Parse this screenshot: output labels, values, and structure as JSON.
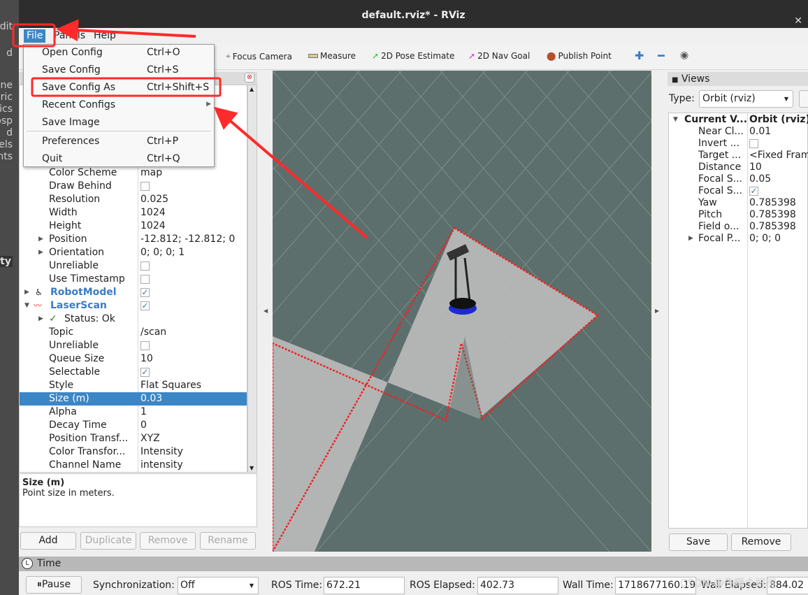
{
  "background_fragments": [
    "dit",
    "d",
    "ne",
    "eric",
    "sics",
    "nosp",
    "d",
    "dels",
    "nts",
    "rty"
  ],
  "window": {
    "title": "default.rviz* - RViz"
  },
  "menubar": [
    "File",
    "Panels",
    "Help"
  ],
  "file_menu": [
    {
      "label": "Open Config",
      "shortcut": "Ctrl+O"
    },
    {
      "label": "Save Config",
      "shortcut": "Ctrl+S"
    },
    {
      "label": "Save Config As",
      "shortcut": "Ctrl+Shift+S"
    },
    {
      "label": "Recent Configs",
      "shortcut": ""
    },
    {
      "label": "Save Image",
      "shortcut": ""
    },
    {
      "label": "Preferences",
      "shortcut": "Ctrl+P"
    },
    {
      "label": "Quit",
      "shortcut": "Ctrl+Q"
    }
  ],
  "toolbar": [
    "Focus Camera",
    "Measure",
    "2D Pose Estimate",
    "2D Nav Goal",
    "Publish Point"
  ],
  "displays": {
    "rows": [
      {
        "k": "Color Scheme",
        "v": "map"
      },
      {
        "k": "Draw Behind",
        "v": ""
      },
      {
        "k": "Resolution",
        "v": "0.025"
      },
      {
        "k": "Width",
        "v": "1024"
      },
      {
        "k": "Height",
        "v": "1024"
      },
      {
        "k": "Position",
        "v": "-12.812; -12.812; 0"
      },
      {
        "k": "Orientation",
        "v": "0; 0; 0; 1"
      },
      {
        "k": "Unreliable",
        "v": ""
      },
      {
        "k": "Use Timestamp",
        "v": ""
      },
      {
        "k": "RobotModel",
        "v": ""
      },
      {
        "k": "LaserScan",
        "v": ""
      },
      {
        "k": "Status: Ok",
        "v": ""
      },
      {
        "k": "Topic",
        "v": "/scan"
      },
      {
        "k": "Unreliable",
        "v": ""
      },
      {
        "k": "Queue Size",
        "v": "10"
      },
      {
        "k": "Selectable",
        "v": ""
      },
      {
        "k": "Style",
        "v": "Flat Squares"
      },
      {
        "k": "Size (m)",
        "v": "0.03"
      },
      {
        "k": "Alpha",
        "v": "1"
      },
      {
        "k": "Decay Time",
        "v": "0"
      },
      {
        "k": "Position Transf...",
        "v": "XYZ"
      },
      {
        "k": "Color Transfor...",
        "v": "Intensity"
      },
      {
        "k": "Channel Name",
        "v": "intensity"
      }
    ],
    "description_title": "Size (m)",
    "description": "Point size in meters.",
    "buttons": [
      "Add",
      "Duplicate",
      "Remove",
      "Rename"
    ]
  },
  "views": {
    "title": "Views",
    "type_label": "Type:",
    "type_value": "Orbit (rviz)",
    "rows": [
      {
        "k": "Current V...",
        "v": "Orbit (rviz)"
      },
      {
        "k": "Near Cl...",
        "v": "0.01"
      },
      {
        "k": "Invert ...",
        "v": ""
      },
      {
        "k": "Target ...",
        "v": "<Fixed Frame>"
      },
      {
        "k": "Distance",
        "v": "10"
      },
      {
        "k": "Focal S...",
        "v": "0.05"
      },
      {
        "k": "Focal S...",
        "v": ""
      },
      {
        "k": "Yaw",
        "v": "0.785398"
      },
      {
        "k": "Pitch",
        "v": "0.785398"
      },
      {
        "k": "Field o...",
        "v": "0.785398"
      },
      {
        "k": "Focal P...",
        "v": "0; 0; 0"
      }
    ],
    "buttons": [
      "Save",
      "Remove"
    ]
  },
  "time": {
    "title": "Time",
    "pause": "Pause",
    "sync_label": "Synchronization:",
    "sync_value": "Off",
    "ros_time_label": "ROS Time:",
    "ros_time": "672.21",
    "ros_elapsed_label": "ROS Elapsed:",
    "ros_elapsed": "402.73",
    "wall_time_label": "Wall Time:",
    "wall_time": "1718677160.19",
    "wall_elapsed_label": "Wall Elapsed:",
    "wall_elapsed": "884.02"
  },
  "watermark": "CSDN @先睡个好觉",
  "colors": {
    "accent": "#3b86c6",
    "annotation": "#ff2a2a",
    "viewport": "#5c6f6c"
  }
}
